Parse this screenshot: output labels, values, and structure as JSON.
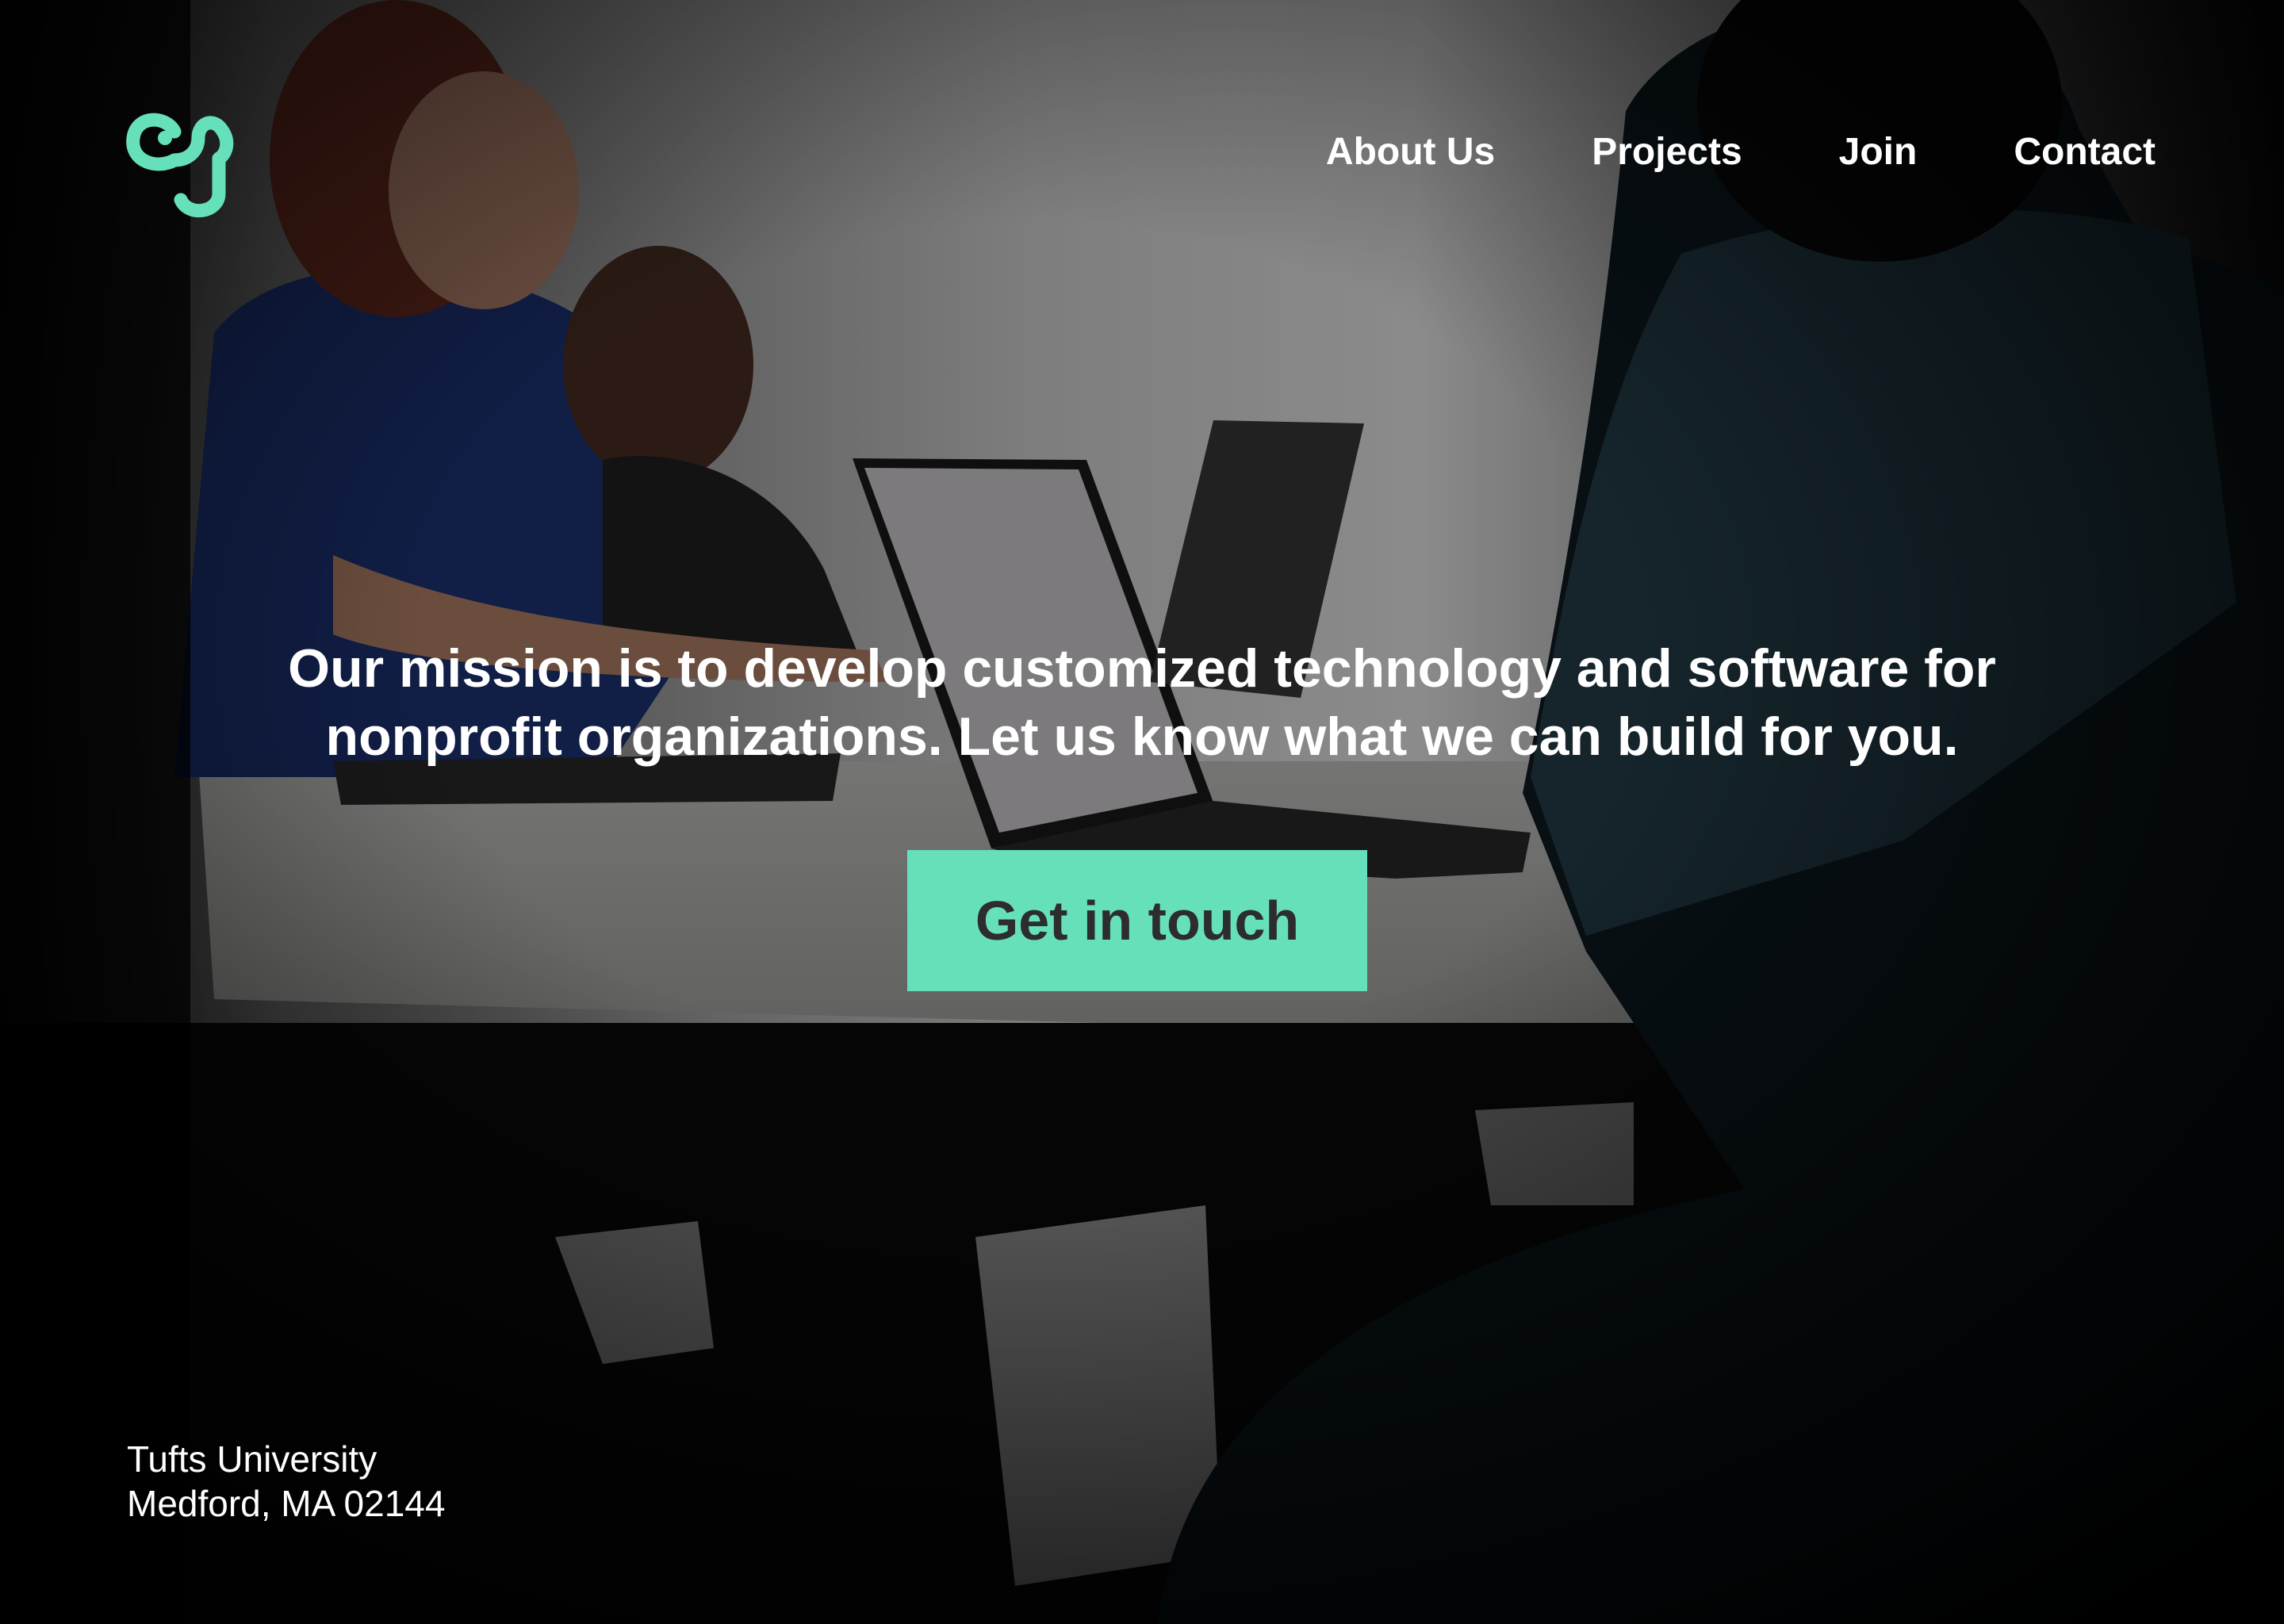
{
  "brand": {
    "logo_icon": "elephant-logo-icon",
    "accent_color": "#66e0bb"
  },
  "nav": {
    "items": [
      {
        "label": "About Us"
      },
      {
        "label": "Projects"
      },
      {
        "label": "Join"
      },
      {
        "label": "Contact"
      }
    ]
  },
  "hero": {
    "line1": "Our mission is to develop customized technology and software for",
    "line2": "nonprofit organizations. Let us know what we can build for you.",
    "cta_label": "Get in touch"
  },
  "footer": {
    "address_line1": "Tufts University",
    "address_line2": "Medford, MA 02144"
  }
}
